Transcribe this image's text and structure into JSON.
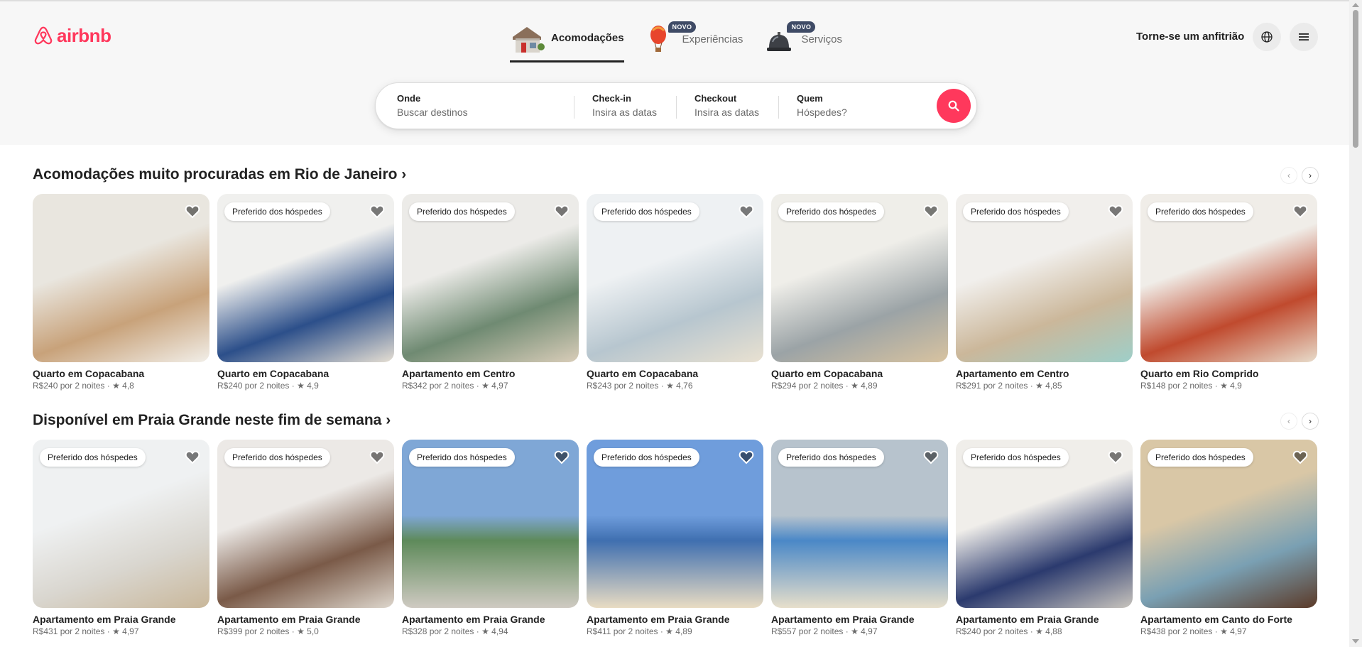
{
  "brand": {
    "name": "airbnb",
    "color": "#ff385c"
  },
  "nav": {
    "tabs": [
      {
        "label": "Acomodações",
        "badge": "",
        "icon": "house-icon",
        "active": true
      },
      {
        "label": "Experiências",
        "badge": "NOVO",
        "icon": "hot-air-balloon-icon",
        "active": false
      },
      {
        "label": "Serviços",
        "badge": "NOVO",
        "icon": "service-bell-icon",
        "active": false
      }
    ]
  },
  "header": {
    "host_link": "Torne-se um anfitrião",
    "language_icon": "globe-icon",
    "menu_icon": "hamburger-menu-icon"
  },
  "search": {
    "where_label": "Onde",
    "where_placeholder": "Buscar destinos",
    "checkin_label": "Check-in",
    "checkin_placeholder": "Insira as datas",
    "checkout_label": "Checkout",
    "checkout_placeholder": "Insira as datas",
    "who_label": "Quem",
    "who_placeholder": "Hóspedes?",
    "button_icon": "search-icon"
  },
  "sections": [
    {
      "title": "Acomodações muito procuradas em Rio de Janeiro ›",
      "listings": [
        {
          "title": "Quarto em Copacabana",
          "meta": "R$240 por 2 noites · ★ 4,8",
          "badge": ""
        },
        {
          "title": "Quarto em Copacabana",
          "meta": "R$240 por 2 noites · ★ 4,9",
          "badge": "Preferido dos hóspedes"
        },
        {
          "title": "Apartamento em Centro",
          "meta": "R$342 por 2 noites · ★ 4,97",
          "badge": "Preferido dos hóspedes"
        },
        {
          "title": "Quarto em Copacabana",
          "meta": "R$243 por 2 noites · ★ 4,76",
          "badge": "Preferido dos hóspedes"
        },
        {
          "title": "Quarto em Copacabana",
          "meta": "R$294 por 2 noites · ★ 4,89",
          "badge": "Preferido dos hóspedes"
        },
        {
          "title": "Apartamento em Centro",
          "meta": "R$291 por 2 noites · ★ 4,85",
          "badge": "Preferido dos hóspedes"
        },
        {
          "title": "Quarto em Rio Comprido",
          "meta": "R$148 por 2 noites · ★ 4,9",
          "badge": "Preferido dos hóspedes"
        }
      ]
    },
    {
      "title": "Disponível em Praia Grande neste fim de semana ›",
      "listings": [
        {
          "title": "Apartamento em Praia Grande",
          "meta": "R$431 por 2 noites · ★ 4,97",
          "badge": "Preferido dos hóspedes"
        },
        {
          "title": "Apartamento em Praia Grande",
          "meta": "R$399 por 2 noites · ★ 5,0",
          "badge": "Preferido dos hóspedes"
        },
        {
          "title": "Apartamento em Praia Grande",
          "meta": "R$328 por 2 noites · ★ 4,94",
          "badge": "Preferido dos hóspedes"
        },
        {
          "title": "Apartamento em Praia Grande",
          "meta": "R$411 por 2 noites · ★ 4,89",
          "badge": "Preferido dos hóspedes"
        },
        {
          "title": "Apartamento em Praia Grande",
          "meta": "R$557 por 2 noites · ★ 4,97",
          "badge": "Preferido dos hóspedes"
        },
        {
          "title": "Apartamento em Praia Grande",
          "meta": "R$240 por 2 noites · ★ 4,88",
          "badge": "Preferido dos hóspedes"
        },
        {
          "title": "Apartamento em Canto do Forte",
          "meta": "R$438 por 2 noites · ★ 4,97",
          "badge": "Preferido dos hóspedes"
        }
      ]
    }
  ]
}
